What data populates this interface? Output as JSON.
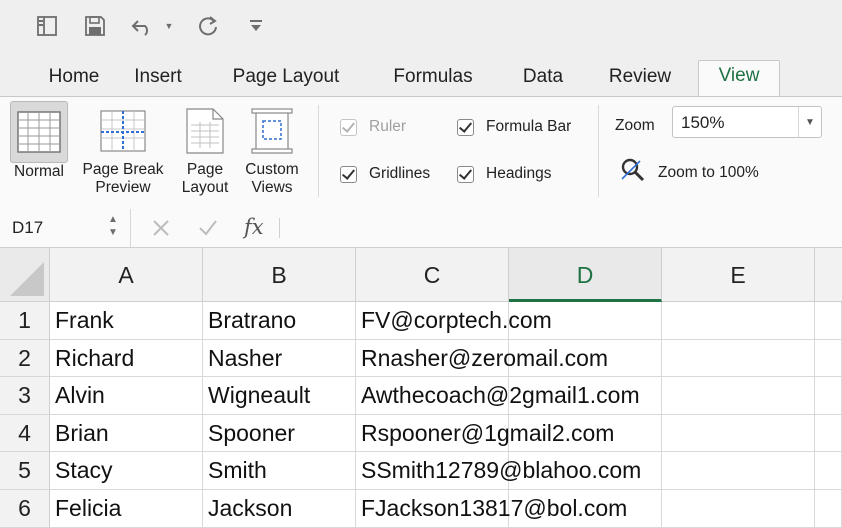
{
  "quick_access": {
    "items": [
      {
        "name": "sidebar-toggle-icon"
      },
      {
        "name": "save-icon"
      },
      {
        "name": "undo-icon"
      },
      {
        "name": "redo-icon"
      },
      {
        "name": "customize-toolbar-icon"
      }
    ]
  },
  "tabs": [
    {
      "label": "Home"
    },
    {
      "label": "Insert"
    },
    {
      "label": "Page Layout"
    },
    {
      "label": "Formulas"
    },
    {
      "label": "Data"
    },
    {
      "label": "Review"
    },
    {
      "label": "View",
      "active": true
    }
  ],
  "ribbon": {
    "views": [
      {
        "label": "Normal",
        "icon": "normal-view-icon",
        "selected": true
      },
      {
        "label": "Page Break\nPreview",
        "icon": "page-break-preview-icon"
      },
      {
        "label": "Page\nLayout",
        "icon": "page-layout-icon"
      },
      {
        "label": "Custom\nViews",
        "icon": "custom-views-icon"
      }
    ],
    "show": {
      "ruler": {
        "label": "Ruler",
        "checked": true,
        "enabled": false
      },
      "formula_bar": {
        "label": "Formula Bar",
        "checked": true,
        "enabled": true
      },
      "gridlines": {
        "label": "Gridlines",
        "checked": true,
        "enabled": true
      },
      "headings": {
        "label": "Headings",
        "checked": true,
        "enabled": true
      }
    },
    "zoom": {
      "label": "Zoom",
      "value": "150%",
      "zoom_to_100_label": "Zoom to 100%"
    }
  },
  "formula_bar": {
    "name_box": "D17",
    "fx": "fx",
    "formula": ""
  },
  "sheet": {
    "columns": [
      "A",
      "B",
      "C",
      "D",
      "E"
    ],
    "selected_column": "D",
    "accent_color": "#1f7244",
    "rows": [
      {
        "num": "1",
        "cells": [
          "Frank",
          "Bratrano",
          "FV@corptech.com",
          "",
          ""
        ]
      },
      {
        "num": "2",
        "cells": [
          "Richard",
          "Nasher",
          "Rnasher@zeromail.com",
          "",
          ""
        ]
      },
      {
        "num": "3",
        "cells": [
          "Alvin",
          "Wigneault",
          "Awthecoach@2gmail1.com",
          "",
          ""
        ]
      },
      {
        "num": "4",
        "cells": [
          "Brian",
          "Spooner",
          "Rspooner@1gmail2.com",
          "",
          ""
        ]
      },
      {
        "num": "5",
        "cells": [
          "Stacy",
          "Smith",
          "SSmith12789@blahoo.com",
          "",
          ""
        ]
      },
      {
        "num": "6",
        "cells": [
          "Felicia",
          "Jackson",
          "FJackson13817@bol.com",
          "",
          ""
        ]
      }
    ]
  }
}
